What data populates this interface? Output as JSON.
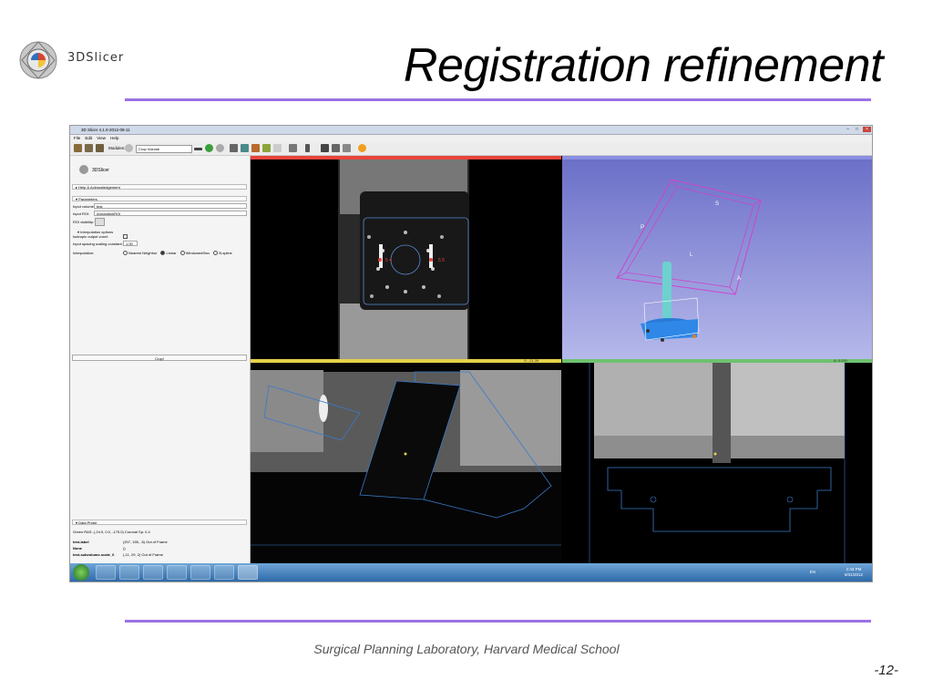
{
  "slide": {
    "title": "Registration refinement",
    "logo_text": "3DSlicer",
    "footer": "Surgical Planning Laboratory, Harvard Medical School",
    "page_number": "-12-"
  },
  "app": {
    "window_title": "3D Slicer 4.1.0-2012-08-11",
    "menu": [
      "File",
      "Edit",
      "View",
      "Help"
    ],
    "modules_label": "Modules:",
    "module_selected": "Crop Volume",
    "panel_logo_text": "3DSlicer",
    "sections": {
      "help": "Help & Acknowledgement",
      "parameters": "Parameters",
      "interpolation": "Interpolation options",
      "data_probe": "Data Probe"
    },
    "fields": {
      "input_volume_label": "Input volume:",
      "input_volume_value": "test",
      "input_roi_label": "Input ROI:",
      "input_roi_value": "AnnotationROI",
      "roi_visibility_label": "ROI visibility:",
      "isotropic_label": "Isotropic output voxel:",
      "spacing_label": "Input spacing scaling constant:",
      "spacing_value": "1.00",
      "interp_label": "Interpolation:",
      "interp_options": [
        "Nearest Neighbor",
        "Linear",
        "WindowedSinc",
        "B-spline"
      ],
      "crop_button": "Crop!"
    },
    "probe": {
      "line1": "Green  RAS: (-24.9, 0.0, -175.0)  Coronal  Sp: 0.4",
      "rows": [
        {
          "name": "test-label",
          "val": "(207, 155, -5) Out of Frame"
        },
        {
          "name": "None",
          "val": "()"
        },
        {
          "name": "test-subvolume-scale_0",
          "val": "(-11, 29, 2)   Out of Frame"
        }
      ]
    },
    "views": {
      "label_p": "P",
      "label_s": "S",
      "label_l": "L",
      "label_a": "A",
      "red_marker_left": "5 4",
      "red_marker_right": "5 5",
      "yellow_value": "S: -21.39",
      "green_value": "A: 0.000"
    },
    "taskbar": {
      "lang": "EN",
      "time": "2:43 PM",
      "date": "8/31/2012"
    }
  },
  "colors": {
    "accent_rule": "#9b72e6",
    "red_view": "#e8453c",
    "yellow_view": "#e6d24a",
    "green_view": "#6ec26e",
    "view3d_bg": "#7a7fd2",
    "roi_magenta": "#cc44cc",
    "model_blue": "#2a7ad8"
  }
}
